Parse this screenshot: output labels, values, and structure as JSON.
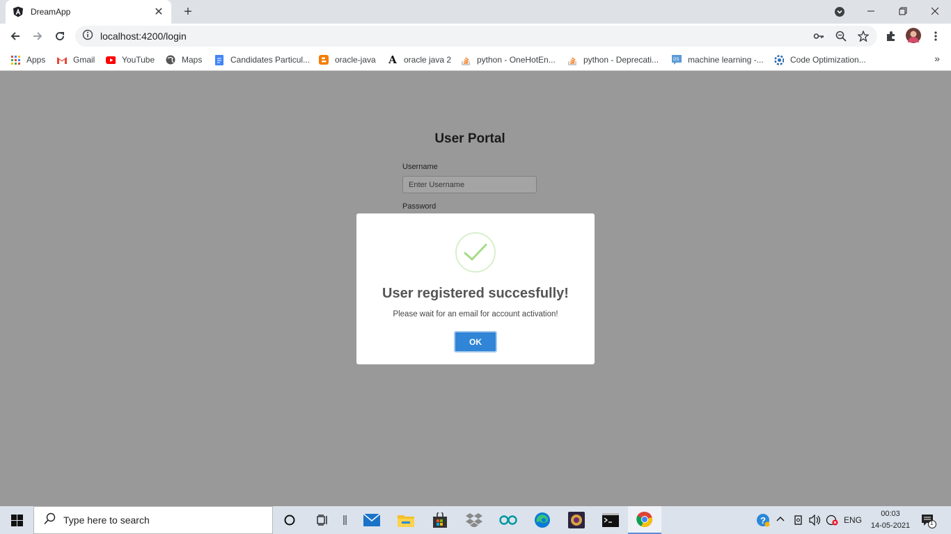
{
  "browser": {
    "tab_title": "DreamApp",
    "url": "localhost:4200/login",
    "bookmarks": [
      {
        "label": "Apps",
        "icon": "apps-grid-icon"
      },
      {
        "label": "Gmail",
        "icon": "gmail-icon"
      },
      {
        "label": "YouTube",
        "icon": "youtube-icon"
      },
      {
        "label": "Maps",
        "icon": "maps-icon"
      },
      {
        "label": "Candidates Particul...",
        "icon": "docs-icon"
      },
      {
        "label": "oracle-java",
        "icon": "blogger-icon"
      },
      {
        "label": "oracle java 2",
        "icon": "font-a-icon"
      },
      {
        "label": "python - OneHotEn...",
        "icon": "stackoverflow-icon"
      },
      {
        "label": "python - Deprecati...",
        "icon": "stackoverflow-icon"
      },
      {
        "label": "machine learning -...",
        "icon": "datascience-icon"
      },
      {
        "label": "Code Optimization...",
        "icon": "code-icon"
      }
    ],
    "bookmarks_more": "»"
  },
  "page": {
    "title": "User Portal",
    "username_label": "Username",
    "username_placeholder": "Enter Username",
    "password_label": "Password"
  },
  "modal": {
    "title": "User registered succesfully!",
    "message": "Please wait for an email for account activation!",
    "ok_label": "OK"
  },
  "taskbar": {
    "search_placeholder": "Type here to search",
    "language": "ENG",
    "time": "00:03",
    "date": "14-05-2021",
    "notification_count": "1"
  },
  "colors": {
    "overlay": "#999999",
    "ok_button": "#3085d6",
    "success_check": "#a5dc86"
  }
}
